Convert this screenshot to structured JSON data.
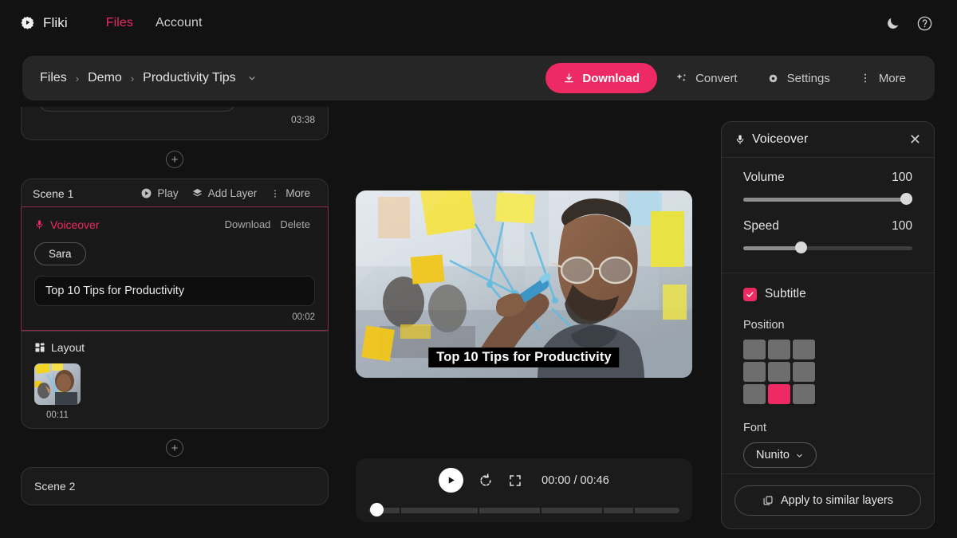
{
  "nav": {
    "brand": "Fliki",
    "brand_logo_icon": "fliki-play-badge-icon",
    "links": [
      {
        "label": "Files",
        "active": true
      },
      {
        "label": "Account",
        "active": false
      }
    ],
    "theme_toggle_icon": "moon-icon",
    "help_icon": "question-circle-icon"
  },
  "toolbar": {
    "breadcrumb": [
      "Files",
      "Demo",
      "Productivity Tips"
    ],
    "breadcrumb_separator": "›",
    "breadcrumb_caret_icon": "chevron-down-icon",
    "download_label": "Download",
    "download_icon": "download-icon",
    "download_color": "#ed2a63",
    "convert_label": "Convert",
    "convert_icon": "sparkles-icon",
    "settings_label": "Settings",
    "settings_icon": "gear-icon",
    "more_label": "More",
    "more_icon": "dots-vertical-icon"
  },
  "scenes": {
    "add_scene_icon": "plus-circle-icon",
    "previous_card": {
      "duration": "03:38"
    },
    "scene1": {
      "title": "Scene 1",
      "play_label": "Play",
      "play_icon": "play-circle-icon",
      "add_layer_label": "Add Layer",
      "add_layer_icon": "layers-icon",
      "more_label": "More",
      "more_icon": "dots-vertical-icon",
      "voiceover": {
        "label": "Voiceover",
        "icon": "microphone-icon",
        "accent": "#ed2a63",
        "download_label": "Download",
        "delete_label": "Delete",
        "voice_name": "Sara",
        "text": "Top 10 Tips for Productivity",
        "duration": "00:02"
      },
      "layout": {
        "label": "Layout",
        "icon": "grid-layout-icon",
        "thumb_duration": "00:11"
      }
    },
    "scene2": {
      "title": "Scene 2"
    }
  },
  "preview": {
    "subtitle_text": "Top 10 Tips for Productivity",
    "image_description": "man writing on glass board with yellow sticky notes"
  },
  "player": {
    "play_icon": "play-icon",
    "replay_icon": "loop-replay-icon",
    "fullscreen_icon": "fullscreen-icon",
    "current_time": "00:00",
    "total_time": "00:46",
    "time_display": "00:00 / 00:46",
    "progress_percent": 0,
    "scene_marker_percents": [
      10,
      35,
      55,
      75,
      85
    ]
  },
  "panel": {
    "title": "Voiceover",
    "title_icon": "microphone-icon",
    "close_icon": "close-icon",
    "volume_label": "Volume",
    "volume_value": "100",
    "volume_percent": 100,
    "speed_label": "Speed",
    "speed_value": "100",
    "speed_percent": 34,
    "subtitle_label": "Subtitle",
    "subtitle_checked": true,
    "check_icon": "checkmark-icon",
    "position_label": "Position",
    "position_selected_index": 7,
    "position_accent": "#ed2a63",
    "font_label": "Font",
    "font_value": "Nunito",
    "font_caret_icon": "chevron-down-icon",
    "apply_label": "Apply to similar layers",
    "apply_icon": "copy-icon"
  }
}
